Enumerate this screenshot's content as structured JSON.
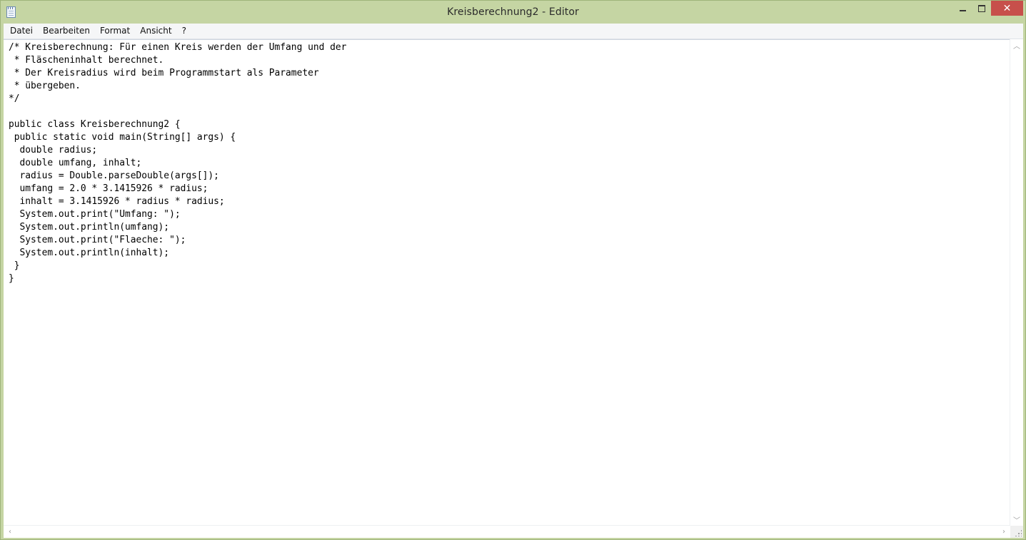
{
  "window": {
    "title": "Kreisberechnung2 - Editor",
    "icon": "notepad-icon",
    "controls": {
      "minimize": "minimize-icon",
      "maximize": "maximize-icon",
      "close": "close-icon",
      "close_color": "#c7504b"
    }
  },
  "menubar": {
    "items": [
      {
        "label": "Datei"
      },
      {
        "label": "Bearbeiten"
      },
      {
        "label": "Format"
      },
      {
        "label": "Ansicht"
      },
      {
        "label": "?"
      }
    ]
  },
  "editor": {
    "lines": [
      "/* Kreisberechnung: Für einen Kreis werden der Umfang und der",
      " * Fläscheninhalt berechnet.",
      " * Der Kreisradius wird beim Programmstart als Parameter",
      " * übergeben.",
      "*/",
      "",
      "public class Kreisberechnung2 {",
      " public static void main(String[] args) {",
      "  double radius;",
      "  double umfang, inhalt;",
      "  radius = Double.parseDouble(args[]);",
      "  umfang = 2.0 * 3.1415926 * radius;",
      "  inhalt = 3.1415926 * radius * radius;",
      "  System.out.print(\"Umfang: \");",
      "  System.out.println(umfang);",
      "  System.out.print(\"Flaeche: \");",
      "  System.out.println(inhalt);",
      " }",
      "}"
    ]
  },
  "colors": {
    "titlebar": "#c5d5a3",
    "menubar": "#f5f6f7",
    "editor_background": "#ffffff"
  }
}
